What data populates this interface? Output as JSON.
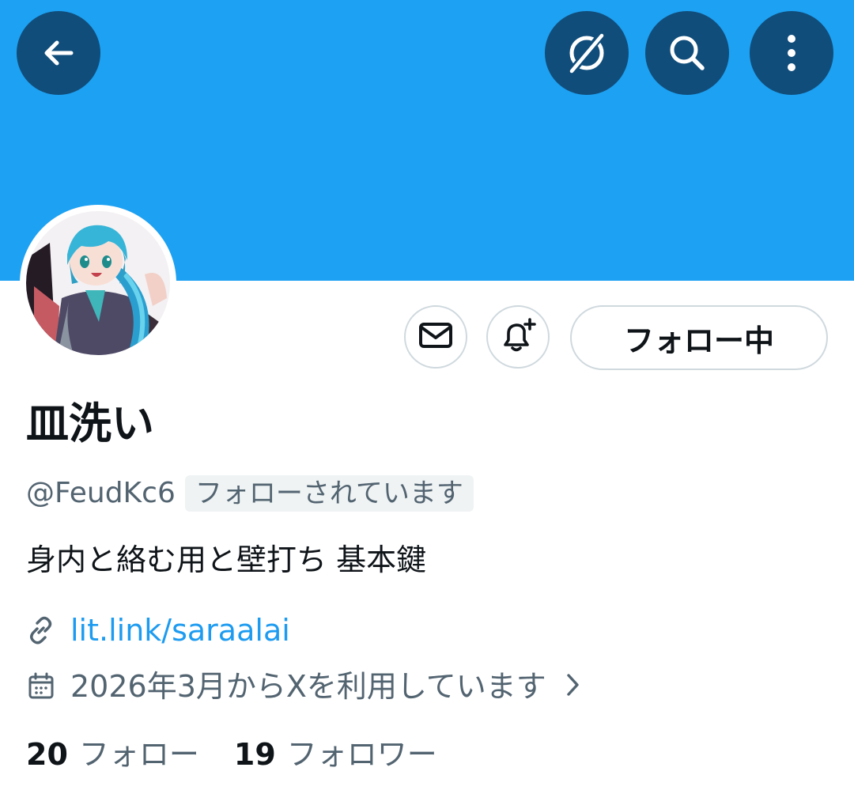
{
  "header": {
    "back_icon": "arrow-left-icon",
    "grok_icon": "grok-icon",
    "search_icon": "search-icon",
    "more_icon": "more-vertical-icon",
    "banner_color": "#1da1f2",
    "button_color": "#104d7b"
  },
  "profile": {
    "display_name": "皿洗い",
    "handle": "@FeudKc6",
    "follows_you": "フォローされています",
    "bio": "身内と絡む用と壁打ち 基本鍵",
    "link": "lit.link/saraalai",
    "joined": "2026年3月からXを利用しています",
    "avatar": "anime-character-avatar"
  },
  "actions": {
    "message_icon": "mail-icon",
    "notify_icon": "bell-plus-icon",
    "follow_label": "フォロー中"
  },
  "stats": {
    "following_count": "20",
    "following_label": "フォロー",
    "followers_count": "19",
    "followers_label": "フォロワー"
  },
  "colors": {
    "link": "#1d9bf0",
    "secondary_text": "#536471",
    "primary_text": "#0f1419"
  }
}
